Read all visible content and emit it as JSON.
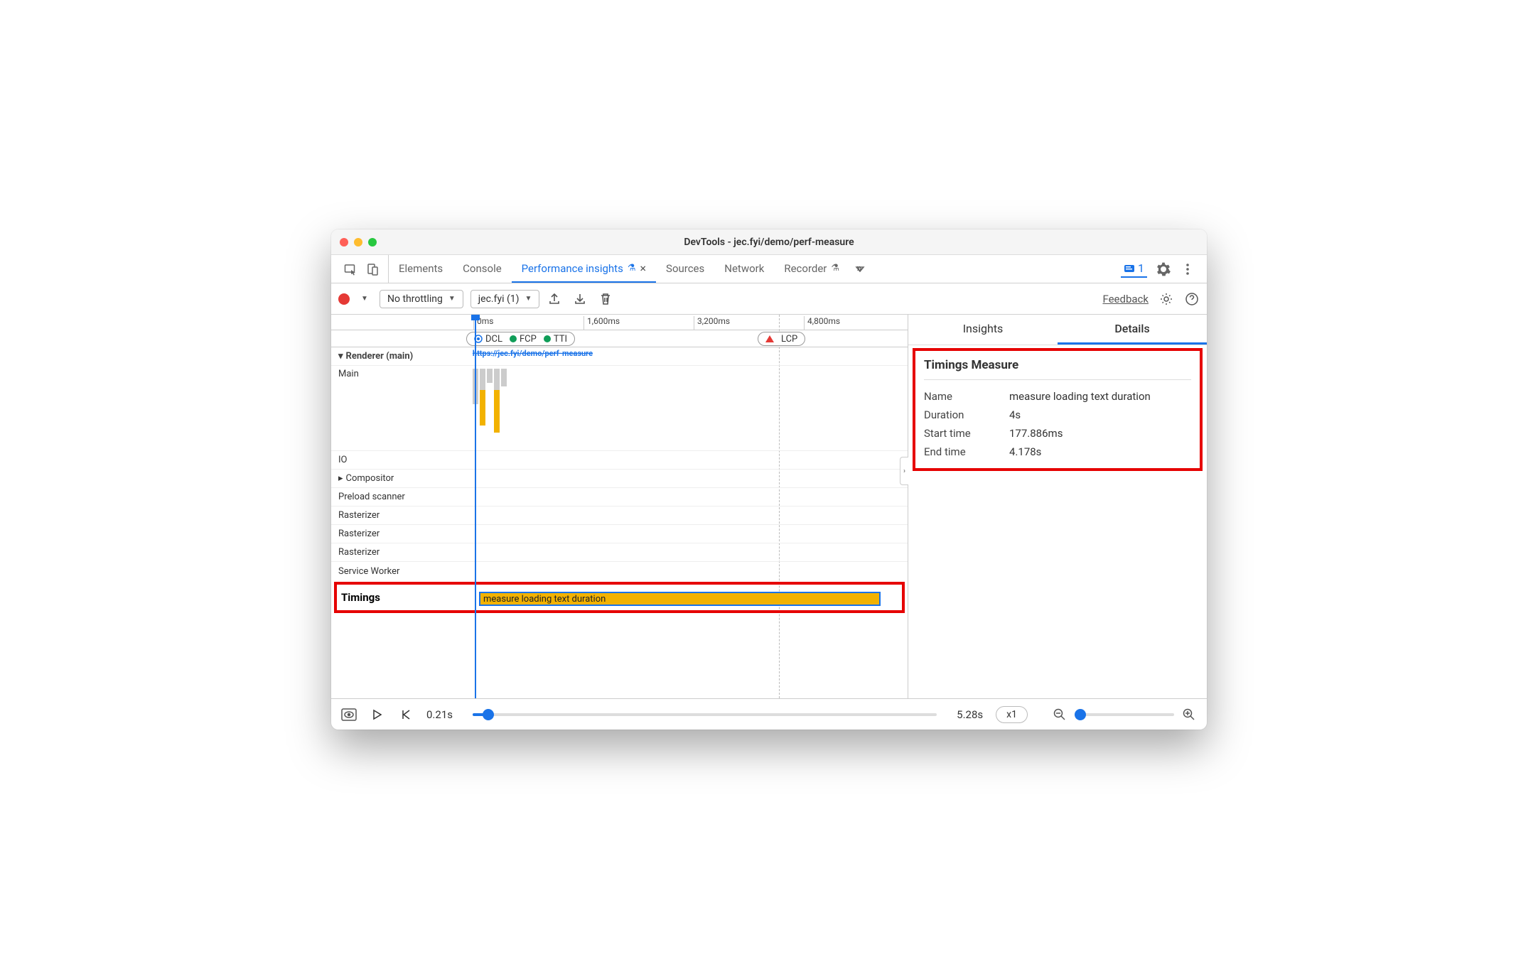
{
  "window": {
    "title": "DevTools - jec.fyi/demo/perf-measure"
  },
  "tabs": {
    "elements": "Elements",
    "console": "Console",
    "perf_insights": "Performance insights",
    "sources": "Sources",
    "network": "Network",
    "recorder": "Recorder",
    "issue_count": "1"
  },
  "toolbar": {
    "throttling": "No throttling",
    "recording_name": "jec.fyi (1)",
    "feedback": "Feedback"
  },
  "ruler": {
    "t0": "0ms",
    "t1": "1,600ms",
    "t2": "3,200ms",
    "t3": "4,800ms"
  },
  "markers": {
    "dcl": "DCL",
    "fcp": "FCP",
    "tti": "TTI",
    "lcp": "LCP"
  },
  "tracks": {
    "renderer": "Renderer (main)",
    "main": "Main",
    "io": "IO",
    "compositor": "Compositor",
    "preload_scanner": "Preload scanner",
    "rasterizer": "Rasterizer",
    "service_worker": "Service Worker",
    "timings": "Timings",
    "url": "https://jec.fyi/demo/perf-measure"
  },
  "timings_bar_label": "measure loading text duration",
  "side": {
    "insights_tab": "Insights",
    "details_tab": "Details",
    "section_title": "Timings Measure",
    "name_k": "Name",
    "name_v": "measure loading text duration",
    "duration_k": "Duration",
    "duration_v": "4s",
    "start_k": "Start time",
    "start_v": "177.886ms",
    "end_k": "End time",
    "end_v": "4.178s"
  },
  "footer": {
    "start_time": "0.21s",
    "end_time": "5.28s",
    "speed": "x1"
  }
}
